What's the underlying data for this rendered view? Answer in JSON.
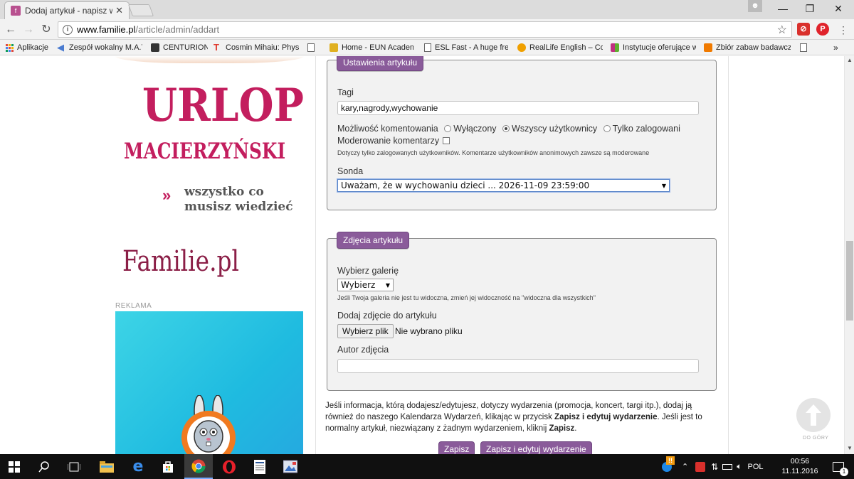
{
  "browser": {
    "tab_title": "Dodaj artykuł - napisz wł",
    "url_host": "www.familie.pl",
    "url_path": "/article/admin/addart"
  },
  "bookmarks": [
    {
      "label": "Aplikacje",
      "color": "#e04a3f"
    },
    {
      "label": "Zespół wokalny M.A.T",
      "color": "#4a7bd0"
    },
    {
      "label": "CENTURION",
      "color": "#333333"
    },
    {
      "label": "Cosmin Mihaiu: Physi",
      "color": "#e03a2f"
    },
    {
      "label": "",
      "color": ""
    },
    {
      "label": "Home - EUN Academ",
      "color": "#e0b020"
    },
    {
      "label": "ESL Fast - A huge free",
      "color": ""
    },
    {
      "label": "RealLife English – Con",
      "color": "#f0a000"
    },
    {
      "label": "Instytucje oferujące w",
      "color": "#c03080"
    },
    {
      "label": "Zbiór zabaw badawcz",
      "color": "#f07a00"
    },
    {
      "label": "",
      "color": ""
    }
  ],
  "sidebar": {
    "promo_title": "URLOP",
    "promo_subtitle": "MACIERZYŃSKI",
    "promo_arrow": "»",
    "promo_text": "wszystko co musisz wiedzieć",
    "brand": "Familie.pl",
    "ad_label": "REKLAMA"
  },
  "settings": {
    "legend": "Ustawienia artykułu",
    "tags_label": "Tagi",
    "tags_value": "kary,nagrody,wychowanie",
    "comments_label": "Możliwość komentowania",
    "comment_options": [
      "Wyłączony",
      "Wszyscy użytkownicy",
      "Tylko zalogowani"
    ],
    "comment_selected": "Wszyscy użytkownicy",
    "moderation_label": "Moderowanie komentarzy",
    "moderation_checked": false,
    "moderation_hint": "Dotyczy tylko zalogowanych użytkowników. Komentarze użytkowników anonimowych zawsze są moderowane",
    "poll_label": "Sonda",
    "poll_value": "Uważam, że w wychowaniu dzieci ... 2026-11-09 23:59:00"
  },
  "photos": {
    "legend": "Zdjęcia artykułu",
    "gallery_label": "Wybierz galerię",
    "gallery_value": "Wybierz",
    "gallery_hint": "Jeśli Twoja galeria nie jest tu widoczna, zmień jej widoczność na \"widoczna dla wszystkich\"",
    "add_photo_label": "Dodaj zdjęcie do artykułu",
    "file_button": "Wybierz plik",
    "file_status": "Nie wybrano pliku",
    "author_label": "Autor zdjęcia",
    "author_value": ""
  },
  "info": {
    "part1": "Jeśli informacja, którą dodajesz/edytujesz, dotyczy wydarzenia (promocja, koncert, targi itp.), dodaj ją również do naszego Kalendarza Wydarzeń, klikając w przycisk ",
    "bold1": "Zapisz i edytuj wydarzenie",
    "part2": ". Jeśli jest to normalny artykuł, niezwiązany z żadnym wydarzeniem, kliknij ",
    "bold2": "Zapisz",
    "part3": "."
  },
  "actions": {
    "save": "Zapisz",
    "save_event": "Zapisz i edytuj wydarzenie"
  },
  "to_top_label": "DO GÓRY",
  "taskbar": {
    "lang": "POL",
    "time": "00:56",
    "date": "11.11.2016",
    "notifications": "1"
  },
  "colors": {
    "accent_purple": "#8a5b9a",
    "promo_pink": "#c31e5e"
  }
}
